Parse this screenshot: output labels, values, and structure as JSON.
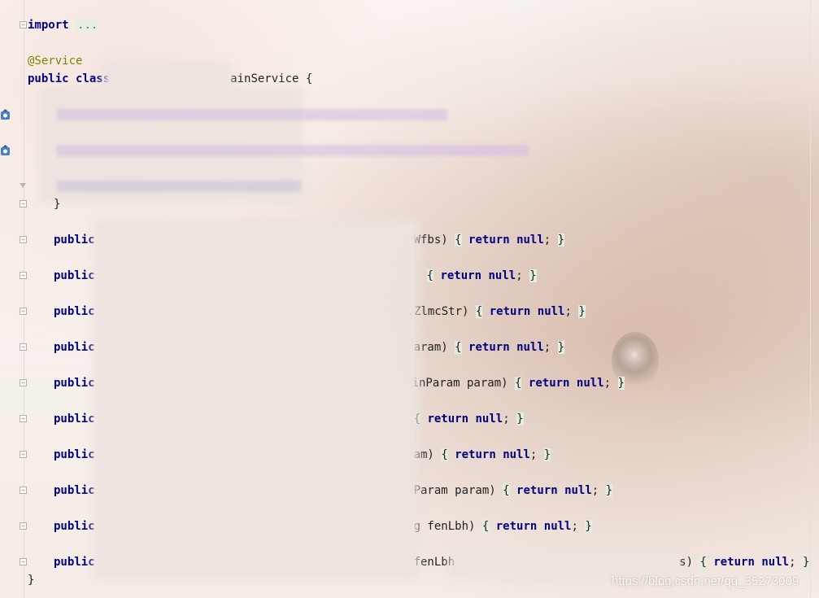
{
  "editor": {
    "import_kw": "import",
    "import_fold": "...",
    "annotation": "@Service",
    "class_decl_kw": "public class",
    "class_name_tail": "ainService {",
    "init_brace_close": "}",
    "closing_brace": "}",
    "methods": [
      {
        "kw": "public",
        "tail": "Wfbs)",
        "body_kw": "return",
        "body_val": "null",
        "end": ";"
      },
      {
        "kw": "public",
        "tail": "",
        "body_kw": "return",
        "body_val": "null",
        "end": ";"
      },
      {
        "kw": "public",
        "tail": ".ZlmcStr)",
        "body_kw": "return",
        "body_val": "null",
        "end": ";"
      },
      {
        "kw": "public",
        "tail": "aram)",
        "body_kw": "return",
        "body_val": "null",
        "end": ";"
      },
      {
        "kw": "public",
        "tail": "inParam param)",
        "body_kw": "return",
        "body_val": "null",
        "end": ";"
      },
      {
        "kw": "public",
        "tail": "",
        "body_kw": "return",
        "body_val": "null",
        "end": ";"
      },
      {
        "kw": "public",
        "tail": "am)",
        "body_kw": "return",
        "body_val": "null",
        "end": ";"
      },
      {
        "kw": "public",
        "tail": "Param param)",
        "body_kw": "return",
        "body_val": "null",
        "end": ";"
      },
      {
        "kw": "public",
        "tail": "g fenLbh)",
        "body_kw": "return",
        "body_val": "null",
        "end": ";"
      },
      {
        "kw": "public",
        "tail": "fenLbh",
        "tail2": "s)",
        "body_kw": "return",
        "body_val": "null",
        "end": ";"
      }
    ]
  },
  "watermark": "https://blog.csdn.net/qq_35273009"
}
